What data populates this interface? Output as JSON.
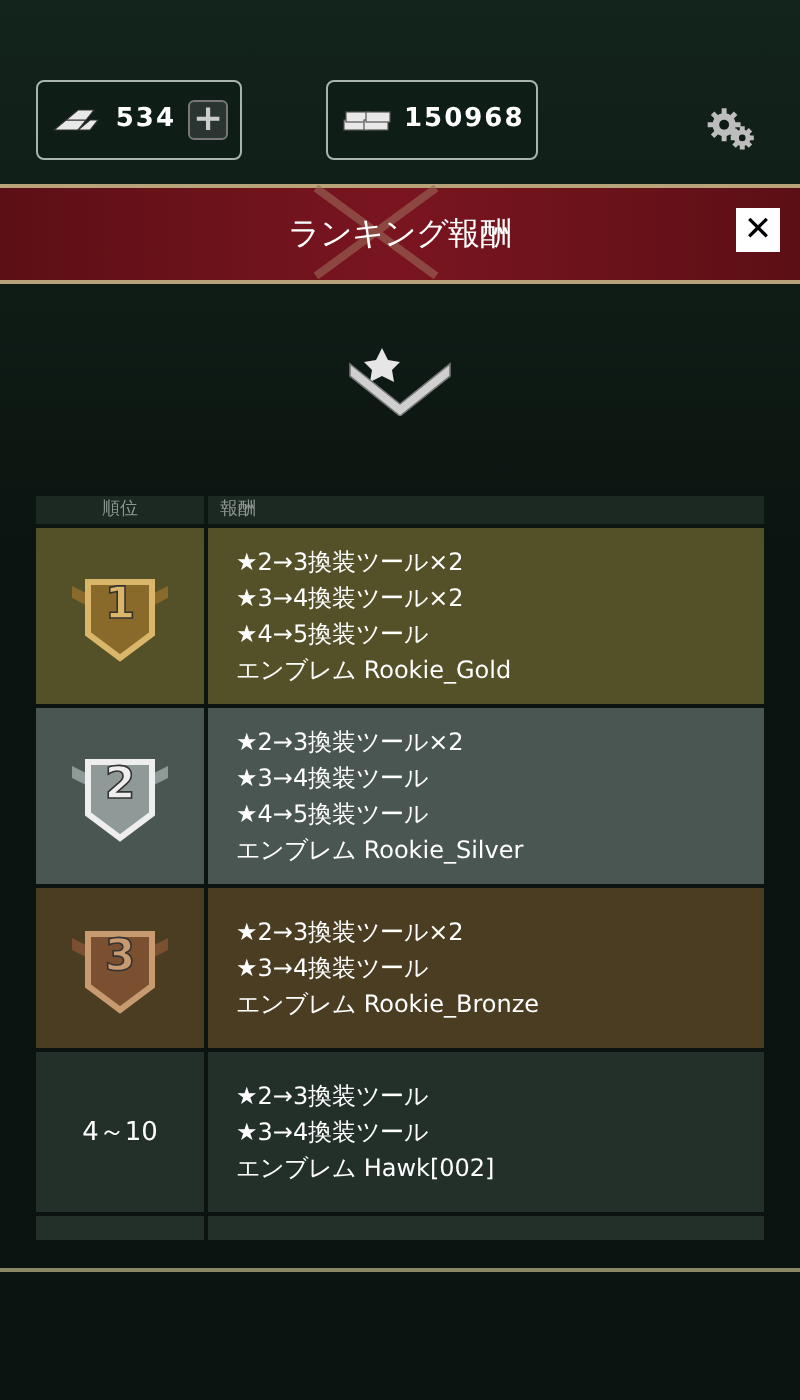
{
  "currencies": [
    {
      "kind": "gold",
      "amount": "534",
      "add_button": "+"
    },
    {
      "kind": "cash",
      "amount": "150968"
    }
  ],
  "header": {
    "title": "ランキング報酬",
    "close": "✕"
  },
  "table": {
    "columns": [
      "順位",
      "報酬"
    ],
    "rows": [
      {
        "kind": "gold",
        "rank": "1",
        "rewards": [
          "★2→3換装ツール×2",
          "★3→4換装ツール×2",
          "★4→5換装ツール",
          "エンブレム Rookie_Gold"
        ]
      },
      {
        "kind": "silver",
        "rank": "2",
        "rewards": [
          "★2→3換装ツール×2",
          "★3→4換装ツール",
          "★4→5換装ツール",
          "エンブレム Rookie_Silver"
        ]
      },
      {
        "kind": "bronze",
        "rank": "3",
        "rewards": [
          "★2→3換装ツール×2",
          "★3→4換装ツール",
          "エンブレム Rookie_Bronze"
        ]
      },
      {
        "kind": "range",
        "rank": "4～10",
        "rewards": [
          "★2→3換装ツール",
          "★3→4換装ツール",
          "エンブレム Hawk[002]"
        ]
      }
    ]
  }
}
